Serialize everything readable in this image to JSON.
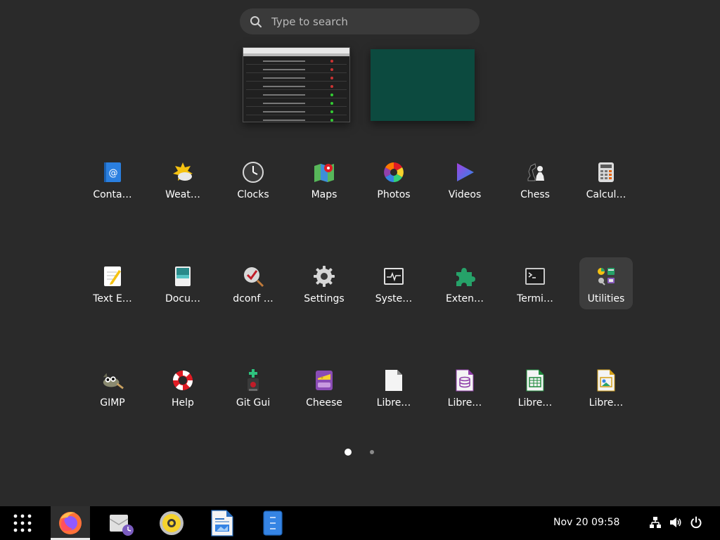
{
  "search": {
    "placeholder": "Type to search",
    "value": ""
  },
  "apps": [
    {
      "label": "Conta…",
      "icon": "contacts-icon"
    },
    {
      "label": "Weat…",
      "icon": "weather-icon"
    },
    {
      "label": "Clocks",
      "icon": "clocks-icon"
    },
    {
      "label": "Maps",
      "icon": "maps-icon"
    },
    {
      "label": "Photos",
      "icon": "photos-icon"
    },
    {
      "label": "Videos",
      "icon": "videos-icon"
    },
    {
      "label": "Chess",
      "icon": "chess-icon"
    },
    {
      "label": "Calcul…",
      "icon": "calculator-icon"
    },
    {
      "label": "Text E…",
      "icon": "text-editor-icon"
    },
    {
      "label": "Docu…",
      "icon": "document-viewer-icon"
    },
    {
      "label": "dconf …",
      "icon": "dconf-editor-icon"
    },
    {
      "label": "Settings",
      "icon": "settings-icon"
    },
    {
      "label": "Syste…",
      "icon": "system-monitor-icon"
    },
    {
      "label": "Exten…",
      "icon": "extensions-icon"
    },
    {
      "label": "Termi…",
      "icon": "terminal-icon"
    },
    {
      "label": "Utilities",
      "icon": "utilities-folder-icon",
      "selected": true
    },
    {
      "label": "GIMP",
      "icon": "gimp-icon"
    },
    {
      "label": "Help",
      "icon": "help-icon"
    },
    {
      "label": "Git Gui",
      "icon": "git-gui-icon"
    },
    {
      "label": "Cheese",
      "icon": "cheese-icon"
    },
    {
      "label": "Libre…",
      "icon": "libreoffice-icon"
    },
    {
      "label": "Libre…",
      "icon": "libreoffice-base-icon"
    },
    {
      "label": "Libre…",
      "icon": "libreoffice-calc-icon"
    },
    {
      "label": "Libre…",
      "icon": "libreoffice-draw-icon"
    }
  ],
  "pager": {
    "pages": 2,
    "current": 1
  },
  "taskbar": {
    "apps": [
      "app-grid-icon",
      "firefox-icon",
      "mail-icon",
      "rhythmbox-icon",
      "libreoffice-writer-icon",
      "file-manager-icon"
    ],
    "clock": "Nov 20  09:58",
    "tray": [
      "network-icon",
      "volume-icon",
      "power-icon"
    ]
  },
  "colors": {
    "background": "#2a2a2a",
    "taskbar": "#000000",
    "search_bg": "#3a3a3a",
    "selected_tile": "#3d3d3d",
    "workspace_2": "#0c4a3f"
  }
}
